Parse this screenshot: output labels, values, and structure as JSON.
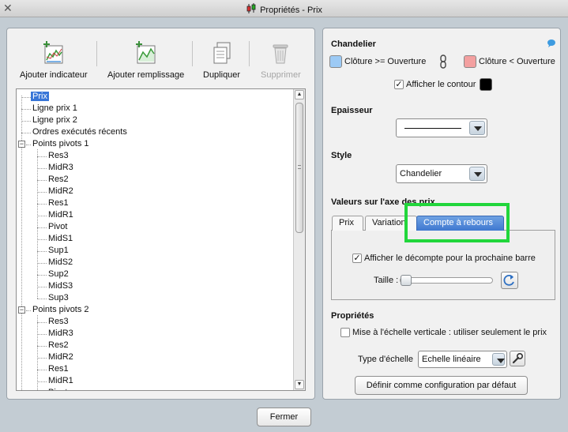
{
  "window": {
    "title": "Propriétés - Prix",
    "close_icon": "close-icon",
    "title_icon": "candlestick-icon"
  },
  "toolbar": {
    "add_indicator": "Ajouter indicateur",
    "add_fill": "Ajouter remplissage",
    "duplicate": "Dupliquer",
    "delete": "Supprimer"
  },
  "tree": {
    "items": [
      {
        "label": "Prix",
        "selected": true
      },
      {
        "label": "Ligne prix 1"
      },
      {
        "label": "Ligne prix 2"
      },
      {
        "label": "Ordres exécutés récents"
      },
      {
        "label": "Points pivots 1",
        "toggle": "−"
      },
      {
        "label": "Res3"
      },
      {
        "label": "MidR3"
      },
      {
        "label": "Res2"
      },
      {
        "label": "MidR2"
      },
      {
        "label": "Res1"
      },
      {
        "label": "MidR1"
      },
      {
        "label": "Pivot"
      },
      {
        "label": "MidS1"
      },
      {
        "label": "Sup1"
      },
      {
        "label": "MidS2"
      },
      {
        "label": "Sup2"
      },
      {
        "label": "MidS3"
      },
      {
        "label": "Sup3"
      },
      {
        "label": "Points pivots 2",
        "toggle": "−"
      },
      {
        "label": "Res3"
      },
      {
        "label": "MidR3"
      },
      {
        "label": "Res2"
      },
      {
        "label": "MidR2"
      },
      {
        "label": "Res1"
      },
      {
        "label": "MidR1"
      },
      {
        "label": "Pivot"
      }
    ]
  },
  "candle": {
    "section_title": "Chandelier",
    "up_label": "Clôture >= Ouverture",
    "down_label": "Clôture < Ouverture",
    "up_color": "#9ccaf5",
    "down_color": "#f3a0a0",
    "outline_label": "Afficher le contour",
    "outline_checked": true,
    "outline_color": "#000000"
  },
  "thickness": {
    "title": "Epaisseur"
  },
  "style": {
    "title": "Style",
    "value": "Chandelier"
  },
  "axis": {
    "title": "Valeurs sur l'axe des prix",
    "tabs": [
      "Prix",
      "Variation",
      "Compte à rebours"
    ],
    "active_tab": 2,
    "countdown_label": "Afficher le décompte pour la prochaine barre",
    "countdown_checked": true,
    "size_label": "Taille :"
  },
  "properties": {
    "title": "Propriétés",
    "scale_label": "Mise à l'échelle verticale : utiliser seulement le prix",
    "scale_checked": false,
    "scale_type_label": "Type d'échelle",
    "scale_type_value": "Echelle linéaire",
    "default_button": "Définir comme configuration par défaut"
  },
  "footer": {
    "close_button": "Fermer"
  },
  "colors": {
    "selection": "#3875d7",
    "highlight": "#21d63b",
    "tab_active": "#4a82d6"
  }
}
